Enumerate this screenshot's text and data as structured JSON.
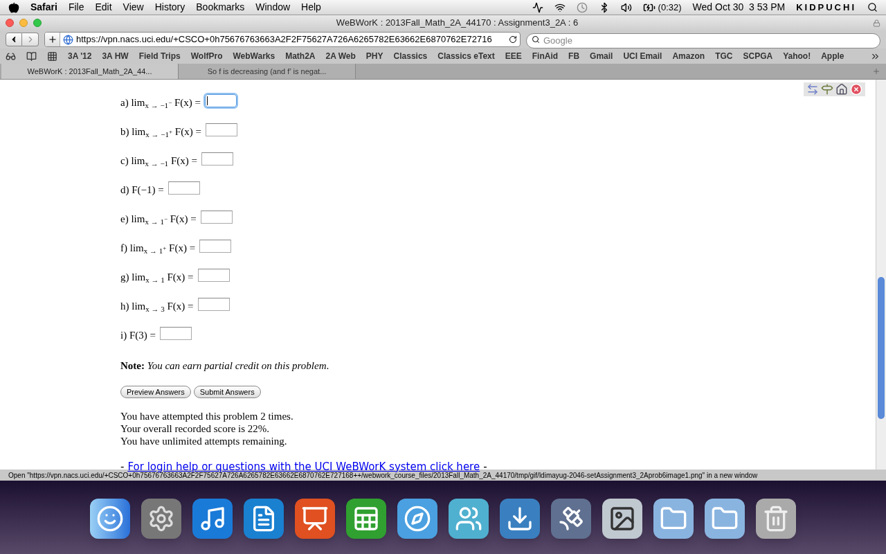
{
  "menubar": {
    "app": "Safari",
    "menus": [
      "File",
      "Edit",
      "View",
      "History",
      "Bookmarks",
      "Window",
      "Help"
    ],
    "battery": "(0:32)",
    "clock": "Wed Oct 30  3 53 PM",
    "user": "KIDPUCHI"
  },
  "window": {
    "title": "WeBWorK : 2013Fall_Math_2A_44170 : Assignment3_2A : 6"
  },
  "toolbar": {
    "url": "https://vpn.nacs.uci.edu/+CSCO+0h75676763663A2F2F75627A726A6265782E63662E6870762E72716",
    "search_placeholder": "Google"
  },
  "bookmarks": [
    "3A '12",
    "3A HW",
    "Field Trips",
    "WolfPro",
    "WebWarks",
    "Math2A",
    "2A Web",
    "PHY",
    "Classics",
    "Classics eText",
    "EEE",
    "FinAid",
    "FB",
    "Gmail",
    "UCI Email",
    "Amazon",
    "TGC",
    "SCPGA",
    "Yahoo!",
    "Apple"
  ],
  "tabs": [
    {
      "label": "WeBWorK : 2013Fall_Math_2A_44...",
      "selected": true
    },
    {
      "label": "So f is decreasing (and f’ is negat...",
      "selected": false
    }
  ],
  "questions": [
    {
      "prefix": "a) lim",
      "sub": "x → −1",
      "sup": "−",
      "suffix": "F(x) =",
      "focused": true
    },
    {
      "prefix": "b) lim",
      "sub": "x → −1",
      "sup": "+",
      "suffix": "F(x) =",
      "focused": false
    },
    {
      "prefix": "c) lim",
      "sub": "x → −1",
      "suffix": "F(x) =",
      "focused": false
    },
    {
      "prefix": "d) F(−1) =",
      "focused": false
    },
    {
      "prefix": "e) lim",
      "sub": "x → 1",
      "sup": "−",
      "suffix": "F(x) =",
      "focused": false
    },
    {
      "prefix": "f) lim",
      "sub": "x → 1",
      "sup": "+",
      "suffix": "F(x) =",
      "focused": false
    },
    {
      "prefix": "g) lim",
      "sub": "x → 1",
      "suffix": "F(x) =",
      "focused": false
    },
    {
      "prefix": "h) lim",
      "sub": "x → 3",
      "suffix": "F(x) =",
      "focused": false
    },
    {
      "prefix": "i) F(3) =",
      "focused": false
    }
  ],
  "note": "**Note:** *You can earn partial credit on this problem*.",
  "buttons": [
    "Preview Answers",
    "Submit Answers"
  ],
  "status_lines": [
    "You have attempted this problem 2 times.",
    "Your overall recorded score is 22%.",
    "You have unlimited attempts remaining."
  ],
  "help_link": {
    "dash_before": "-",
    "text": "For login help or questions with the UCI WeBWorK system click here",
    "dash_after": "-"
  },
  "status_bar": "Open \"https://vpn.nacs.uci.edu/+CSCO+0h75676763663A2F2F75627A726A6265782E63662E6870762E727168++/webwork_course_files/2013Fall_Math_2A_44170/tmp/gif/ldimayug-2046-setAssignment3_2Aprob6image1.png\" in a new window"
}
